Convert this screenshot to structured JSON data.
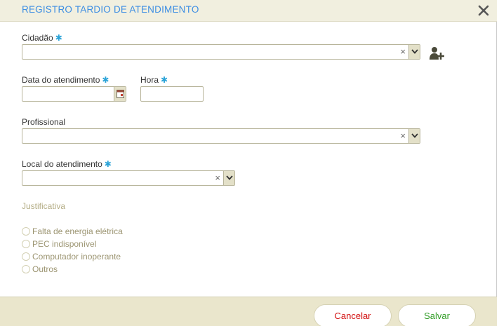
{
  "dialog": {
    "title": "REGISTRO TARDIO DE ATENDIMENTO"
  },
  "fields": {
    "cidadao_label": "Cidadão",
    "data_label": "Data do atendimento",
    "hora_label": "Hora",
    "profissional_label": "Profissional",
    "local_label": "Local do atendimento",
    "required_mark": "✱",
    "clear_mark": "×"
  },
  "justificativa": {
    "title": "Justificativa",
    "options": [
      "Falta de energia elétrica",
      "PEC indisponível",
      "Computador inoperante",
      "Outros"
    ]
  },
  "buttons": {
    "cancel": "Cancelar",
    "save": "Salvar"
  },
  "colors": {
    "title": "#3d8ee3",
    "required": "#2aa3d8",
    "cancel": "#d20f0f",
    "save": "#2d9b22",
    "header_bg": "#f1efdf",
    "footer_bg": "#eae6cc"
  },
  "icons": {
    "close": "close-icon",
    "add_citizen": "add-user-icon",
    "calendar": "calendar-icon",
    "dropdown": "chevron-down-icon"
  }
}
